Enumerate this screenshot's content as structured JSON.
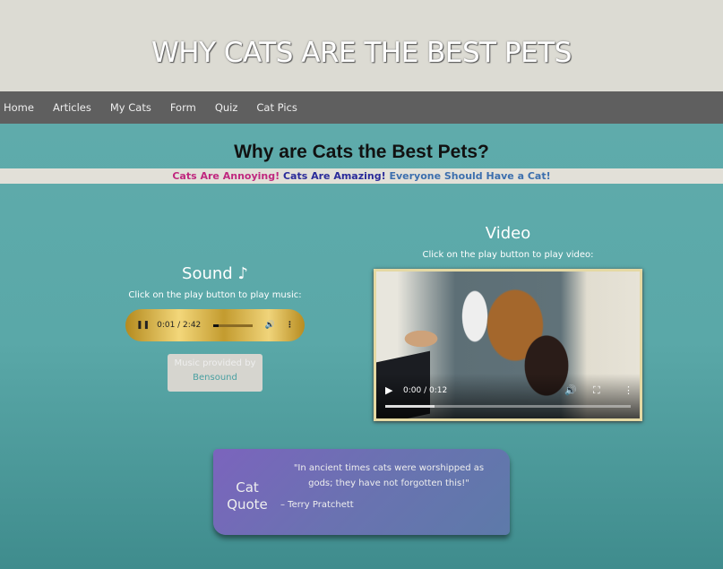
{
  "header": {
    "title": "WHY CATS ARE THE BEST PETS"
  },
  "nav": {
    "items": [
      "Home",
      "Articles",
      "My Cats",
      "Form",
      "Quiz",
      "Cat Pics"
    ]
  },
  "main": {
    "title": "Why are Cats the Best Pets?",
    "banner": [
      "Cats Are Annoying!",
      "Cats Are Amazing!",
      "Everyone Should Have a Cat!"
    ]
  },
  "sound": {
    "heading": "Sound ♪",
    "instruction": "Click on the play button to play music:",
    "time": "0:01 / 2:42",
    "progress": 0.01,
    "credit_line": "Music provided by",
    "credit_link": "Bensound"
  },
  "video": {
    "heading": "Video",
    "instruction": "Click on the play button to play video:",
    "time": "0:00 / 0:12",
    "progress": 0.2
  },
  "quote": {
    "label": "Cat Quote",
    "text": "\"In ancient times cats were worshipped as gods; they have not forgotten this!\"",
    "author": "– Terry Pratchett"
  }
}
